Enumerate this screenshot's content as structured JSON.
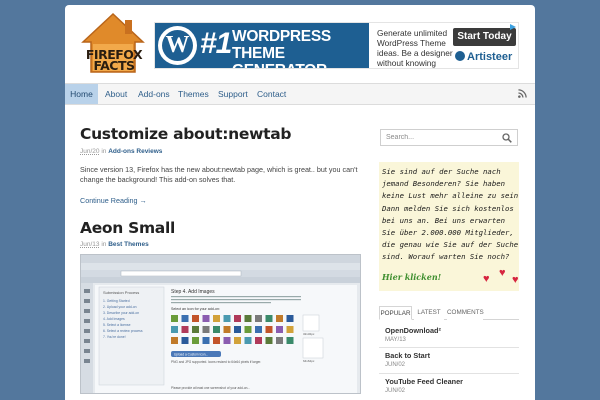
{
  "logo": {
    "line1": "FIREFOX",
    "line2": "FACTS"
  },
  "ad": {
    "number": "#1",
    "title_line1": "WORDPRESS",
    "title_line2": "THEME GENERATOR",
    "description": "Generate unlimited WordPress Theme ideas. Be a designer without knowing HTML.",
    "button": "Start Today",
    "brand": "Artisteer"
  },
  "nav": {
    "items": [
      "Home",
      "About",
      "Add-ons",
      "Themes",
      "Support",
      "Contact"
    ],
    "active": "Home"
  },
  "posts": [
    {
      "title": "Customize about:newtab",
      "date": "Jun/20",
      "in": "in",
      "category": "Add-ons Reviews",
      "excerpt": "Since version 13, Firefox has the new about:newtab page, which is great.. but you can't change the background! This add-on solves that.",
      "read_more": "Continue Reading →"
    },
    {
      "title": "Aeon Small",
      "date": "Jun/13",
      "in": "in",
      "category": "Best Themes"
    }
  ],
  "screenshot": {
    "panel_title": "Submission Process",
    "steps": [
      "1. Getting Started",
      "2. Upload your add-on",
      "3. Describe your add-on",
      "4. Add Images",
      "5. Select a license",
      "6. Select a review process",
      "7. You're done!"
    ],
    "heading": "Step 4. Add Images",
    "body": "Custom icons and screenshots draw attention and help users understand what it does. We strongly recommend uploading a custom icon, as in some areas of the website, only the icon and name will appear.",
    "icon_label": "Select an icon for your add-on:",
    "upload_button": "Upload a Custom Icon...",
    "note": "PNG and JPG supported. Icons resized to 64x64 pixels if larger.",
    "size1": "32x32px",
    "size2": "64x64px",
    "bottom_text": "Please provide at least one screenshot of your add-on..."
  },
  "sidebar": {
    "search_placeholder": "Search...",
    "ad_lines": [
      "Sie sind auf der Suche nach",
      "jemand Besonderen? Sie haben",
      "keine Lust mehr alleine zu sein?",
      "Dann melden Sie sich kostenlos",
      "bei uns an. Bei uns erwarten",
      "Sie über 2.000.000 Mitglieder,",
      "die genau wie Sie auf der Suche",
      "sind. Worauf warten Sie noch?"
    ],
    "ad_cta": "Hier klicken!",
    "tabs": [
      "POPULAR",
      "LATEST",
      "COMMENTS"
    ],
    "active_tab": "POPULAR",
    "popular": [
      {
        "title": "OpenDownload²",
        "date": "MAY/13"
      },
      {
        "title": "Back to Start",
        "date": "JUN/02"
      },
      {
        "title": "YouTube Feed Cleaner",
        "date": "JUN/02"
      }
    ]
  },
  "colors": {
    "background": "#53779d",
    "link": "#2e5e8a",
    "nav_active": "#b9d2ea",
    "ad_blue": "#1e5f92"
  }
}
